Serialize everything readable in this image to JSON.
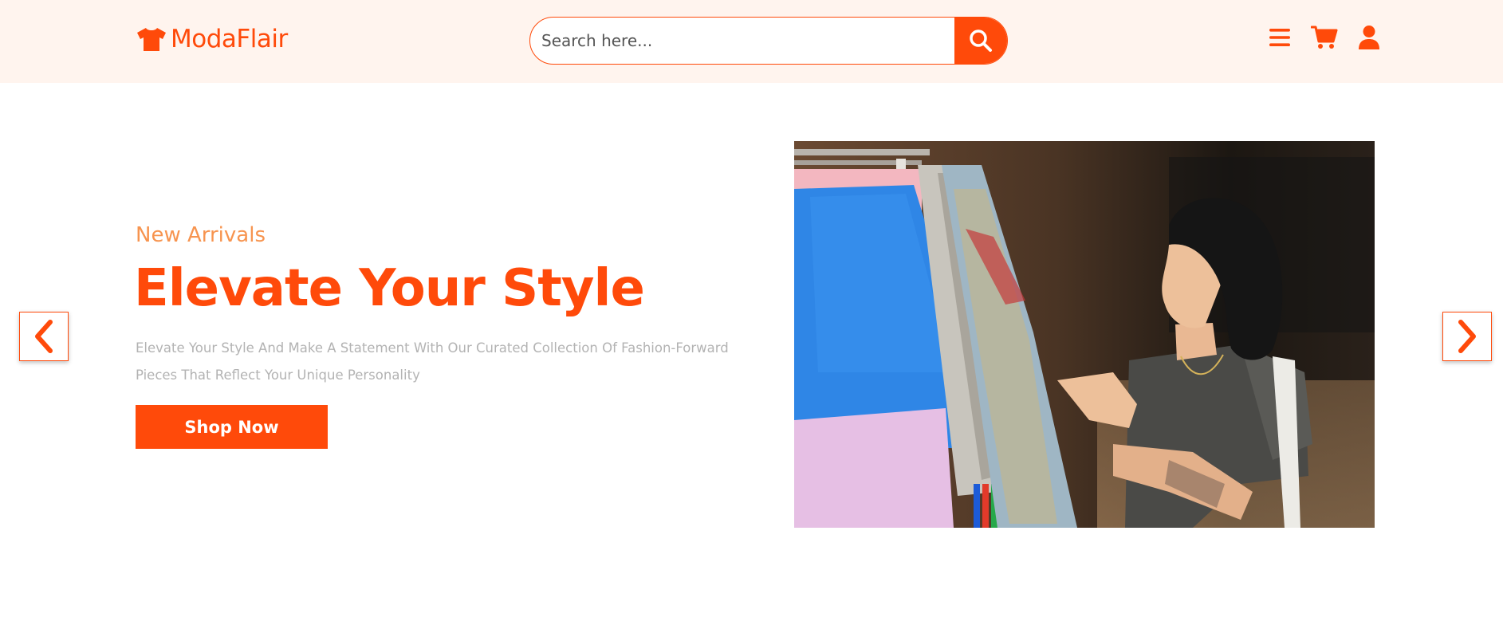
{
  "brand": {
    "name": "ModaFlair",
    "accent": "#ff4a0a",
    "header_bg": "#fff4ee"
  },
  "search": {
    "placeholder": "Search here...",
    "value": ""
  },
  "header_icons": [
    "menu-icon",
    "cart-icon",
    "user-icon"
  ],
  "hero": {
    "subtitle": "New Arrivals",
    "title": "Elevate Your Style",
    "description": "Elevate Your Style And Make A Statement With Our Curated Collection Of Fashion-Forward Pieces That Reflect Your Unique Personality",
    "cta_label": "Shop Now",
    "subtitle_color": "#f7944f"
  },
  "carousel": {
    "prev_icon": "chevron-left-icon",
    "next_icon": "chevron-right-icon"
  }
}
